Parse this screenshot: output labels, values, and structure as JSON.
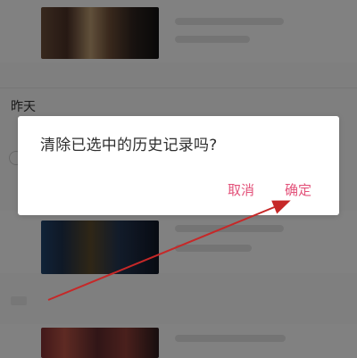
{
  "history": {
    "date_label": "昨天"
  },
  "dialog": {
    "title": "清除已选中的历史记录吗?",
    "cancel_label": "取消",
    "confirm_label": "确定"
  },
  "colors": {
    "accent": "#e3527a",
    "annotation_arrow": "#c62828"
  }
}
